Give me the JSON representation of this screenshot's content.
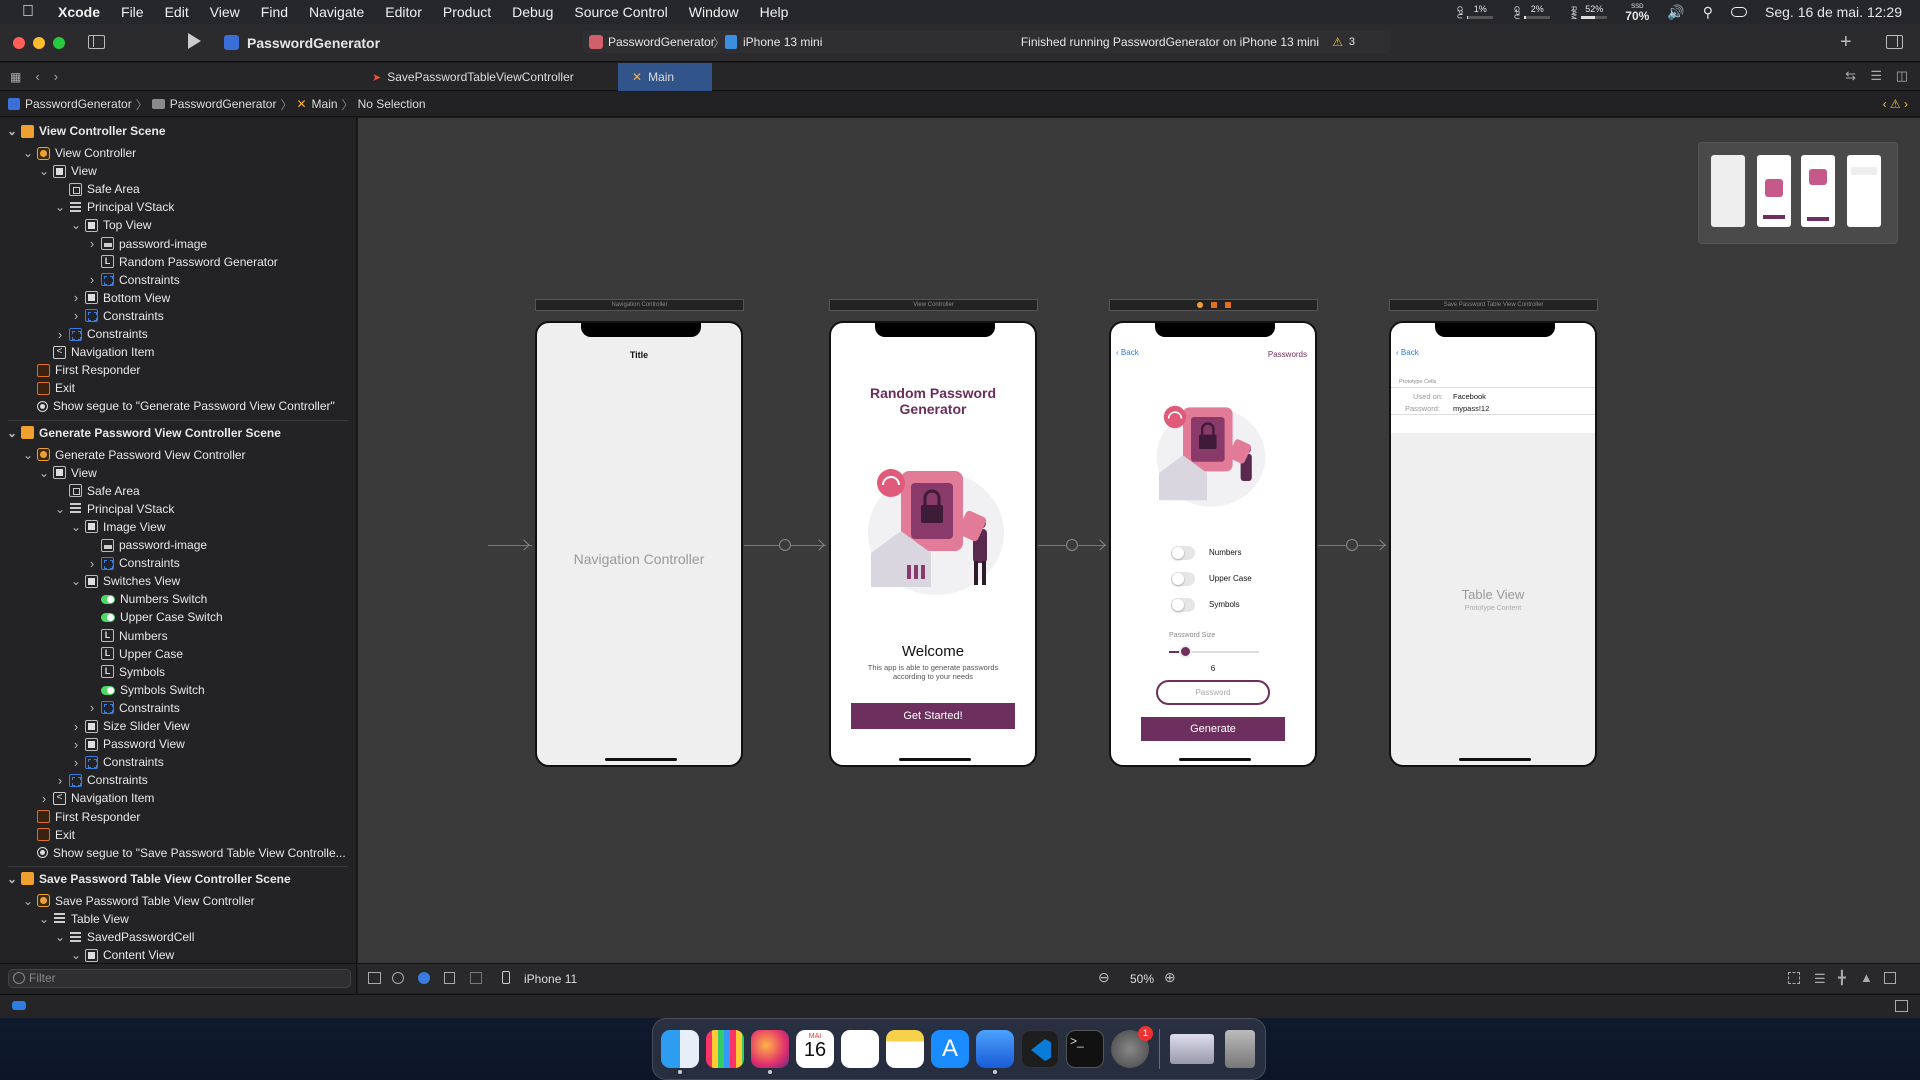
{
  "menubar": {
    "app": "Xcode",
    "items": [
      "File",
      "Edit",
      "View",
      "Find",
      "Navigate",
      "Editor",
      "Product",
      "Debug",
      "Source Control",
      "Window",
      "Help"
    ],
    "cpu": "1%",
    "gpu": "2%",
    "ram": "52%",
    "ssd": "70%",
    "cpu_lbl": "CPU",
    "gpu_lbl": "GPU",
    "ram_lbl": "RAM",
    "ssd_lbl": "SSD",
    "datetime": "Seg. 16 de mai.  12:29",
    "cpu_fill": 0.01,
    "gpu_fill": 0.02,
    "ram_fill": 0.52
  },
  "toolbar": {
    "project": "PasswordGenerator",
    "scheme": "PasswordGenerator",
    "device": "iPhone 13 mini",
    "status": "Finished running PasswordGenerator on iPhone 13 mini",
    "warnings": "3"
  },
  "tabs": {
    "tab1": "SavePasswordTableViewController",
    "tab2": "Main"
  },
  "jumpbar": {
    "items": [
      "PasswordGenerator",
      "PasswordGenerator",
      "Main",
      "No Selection"
    ]
  },
  "outline": [
    {
      "t": "View Controller Scene",
      "d": 0,
      "ic": "scenei",
      "scene": true,
      "disc": "v"
    },
    {
      "t": "View Controller",
      "d": 1,
      "ic": "vc",
      "disc": "v"
    },
    {
      "t": "View",
      "d": 2,
      "ic": "view",
      "disc": "v"
    },
    {
      "t": "Safe Area",
      "d": 3,
      "ic": "safe"
    },
    {
      "t": "Principal VStack",
      "d": 3,
      "ic": "stack",
      "disc": "v"
    },
    {
      "t": "Top View",
      "d": 4,
      "ic": "view",
      "disc": "v"
    },
    {
      "t": "password-image",
      "d": 5,
      "ic": "img",
      "disc": ">"
    },
    {
      "t": "Random Password  Generator",
      "d": 5,
      "ic": "lbl"
    },
    {
      "t": "Constraints",
      "d": 5,
      "ic": "cons",
      "disc": ">"
    },
    {
      "t": "Bottom View",
      "d": 4,
      "ic": "view",
      "disc": ">"
    },
    {
      "t": "Constraints",
      "d": 4,
      "ic": "cons",
      "disc": ">"
    },
    {
      "t": "Constraints",
      "d": 3,
      "ic": "cons",
      "disc": ">"
    },
    {
      "t": "Navigation Item",
      "d": 2,
      "ic": "navi"
    },
    {
      "t": "First Responder",
      "d": 1,
      "ic": "fr"
    },
    {
      "t": "Exit",
      "d": 1,
      "ic": "exit"
    },
    {
      "t": "Show segue to \"Generate Password View Controller\"",
      "d": 1,
      "ic": "seg"
    },
    {
      "t": "Generate Password View Controller Scene",
      "d": 0,
      "ic": "scenei",
      "scene": true,
      "disc": "v",
      "sepBefore": true
    },
    {
      "t": "Generate Password View Controller",
      "d": 1,
      "ic": "vc",
      "disc": "v"
    },
    {
      "t": "View",
      "d": 2,
      "ic": "view",
      "disc": "v"
    },
    {
      "t": "Safe Area",
      "d": 3,
      "ic": "safe"
    },
    {
      "t": "Principal VStack",
      "d": 3,
      "ic": "stack",
      "disc": "v"
    },
    {
      "t": "Image View",
      "d": 4,
      "ic": "view",
      "disc": "v"
    },
    {
      "t": "password-image",
      "d": 5,
      "ic": "img"
    },
    {
      "t": "Constraints",
      "d": 5,
      "ic": "cons",
      "disc": ">"
    },
    {
      "t": "Switches View",
      "d": 4,
      "ic": "view",
      "disc": "v"
    },
    {
      "t": "Numbers Switch",
      "d": 5,
      "ic": "sw"
    },
    {
      "t": "Upper Case Switch",
      "d": 5,
      "ic": "sw"
    },
    {
      "t": "Numbers",
      "d": 5,
      "ic": "lbl"
    },
    {
      "t": "Upper Case",
      "d": 5,
      "ic": "lbl"
    },
    {
      "t": "Symbols",
      "d": 5,
      "ic": "lbl"
    },
    {
      "t": "Symbols Switch",
      "d": 5,
      "ic": "sw"
    },
    {
      "t": "Constraints",
      "d": 5,
      "ic": "cons",
      "disc": ">"
    },
    {
      "t": "Size Slider View",
      "d": 4,
      "ic": "view",
      "disc": ">"
    },
    {
      "t": "Password View",
      "d": 4,
      "ic": "view",
      "disc": ">"
    },
    {
      "t": "Constraints",
      "d": 4,
      "ic": "cons",
      "disc": ">"
    },
    {
      "t": "Constraints",
      "d": 3,
      "ic": "cons",
      "disc": ">"
    },
    {
      "t": "Navigation Item",
      "d": 2,
      "ic": "navi",
      "disc": ">"
    },
    {
      "t": "First Responder",
      "d": 1,
      "ic": "fr"
    },
    {
      "t": "Exit",
      "d": 1,
      "ic": "exit"
    },
    {
      "t": "Show segue to \"Save Password Table View Controlle...",
      "d": 1,
      "ic": "seg"
    },
    {
      "t": "Save Password Table View Controller Scene",
      "d": 0,
      "ic": "scenei",
      "scene": true,
      "disc": "v",
      "sepBefore": true
    },
    {
      "t": "Save Password Table View Controller",
      "d": 1,
      "ic": "vc",
      "disc": "v"
    },
    {
      "t": "Table View",
      "d": 2,
      "ic": "stack",
      "disc": "v"
    },
    {
      "t": "SavedPasswordCell",
      "d": 3,
      "ic": "stack",
      "disc": "v"
    },
    {
      "t": "Content View",
      "d": 4,
      "ic": "view",
      "disc": "v"
    }
  ],
  "filter": {
    "placeholder": "Filter"
  },
  "canvas_bottom": {
    "device": "iPhone 11",
    "zoom": "50%"
  },
  "scenes": {
    "nav": {
      "header": "Navigation Controller",
      "title": "Title",
      "body": "Navigation Controller"
    },
    "vc": {
      "header": "View Controller",
      "heading": "Random Password\nGenerator",
      "welcome": "Welcome",
      "desc": "This app is able to generate passwords according to your needs",
      "button": "Get Started!"
    },
    "gen": {
      "back": "Back",
      "right": "Passwords",
      "toggles": [
        "Numbers",
        "Upper Case",
        "Symbols"
      ],
      "size_label": "Password Size",
      "size_value": "6",
      "placeholder": "Password",
      "button": "Generate"
    },
    "save": {
      "header": "Save Password Table View Controller",
      "back": "Back",
      "section": "Prototype Cells",
      "used_on_label": "Used on:",
      "used_on_value": "Facebook",
      "password_label": "Password:",
      "password_value": "mypass!12",
      "table_title": "Table View",
      "table_sub": "Prototype Content"
    }
  },
  "dock": {
    "calendar_month": "MAI",
    "calendar_day": "16",
    "badge": "1"
  },
  "colors": {
    "accent": "#6d2f5e",
    "menubar": "#25272a"
  }
}
